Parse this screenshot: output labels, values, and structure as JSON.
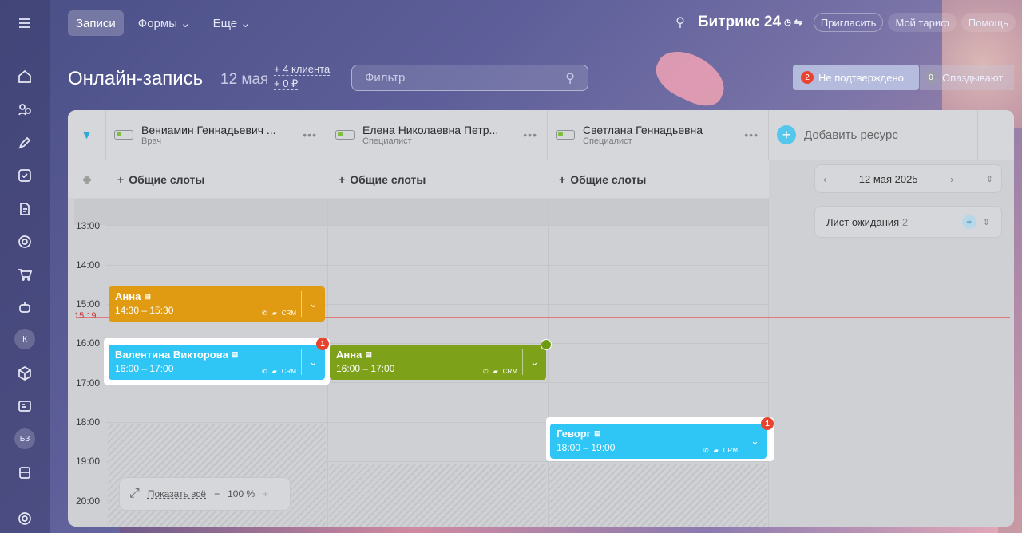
{
  "topnav": {
    "items": [
      {
        "label": "Записи",
        "active": true
      },
      {
        "label": "Формы",
        "dropdown": true
      },
      {
        "label": "Еще",
        "dropdown": true
      }
    ]
  },
  "brand": {
    "name": "Битрикс 24"
  },
  "topbar": {
    "invite": "Пригласить",
    "tariff": "Мой тариф",
    "help": "Помощь"
  },
  "sidebar": {
    "badge_k": "К",
    "badge_bz": "БЗ"
  },
  "header": {
    "title": "Онлайн-запись",
    "date": "12 мая",
    "stat_clients": "+ 4 клиента",
    "stat_money": "+ 0 ₽",
    "filter_placeholder": "Фильтр",
    "unconfirmed_count": "2",
    "unconfirmed_label": "Не подтверждено",
    "late_count": "0",
    "late_label": "Опаздывают"
  },
  "resources": [
    {
      "name": "Вениамин Геннадьевич ...",
      "role": "Врач"
    },
    {
      "name": "Елена Николаевна Петр...",
      "role": "Специалист"
    },
    {
      "name": "Светлана Геннадьевна",
      "role": "Специалист"
    }
  ],
  "add_resource": "Добавить ресурс",
  "common_slots": "Общие слоты",
  "hours": [
    "13:00",
    "14:00",
    "15:00",
    "16:00",
    "17:00",
    "18:00",
    "19:00",
    "20:00"
  ],
  "now_time": "15:19",
  "bookings": [
    {
      "name": "Анна",
      "time": "14:30 – 15:30",
      "color": "#e09b12"
    },
    {
      "name": "Валентина Викторова",
      "time": "16:00 – 17:00",
      "color": "#2fc6f6",
      "badge": "1"
    },
    {
      "name": "Анна",
      "time": "16:00 – 17:00",
      "color": "#7ea11a"
    },
    {
      "name": "Геворг",
      "time": "18:00 – 19:00",
      "color": "#2fc6f6",
      "badge": "1"
    }
  ],
  "crm_label": "CRM",
  "side_panel": {
    "date": "12 мая 2025",
    "waitlist_label": "Лист ожидания",
    "waitlist_count": "2"
  },
  "zoom": {
    "show_all": "Показать всё",
    "level": "100 %"
  }
}
